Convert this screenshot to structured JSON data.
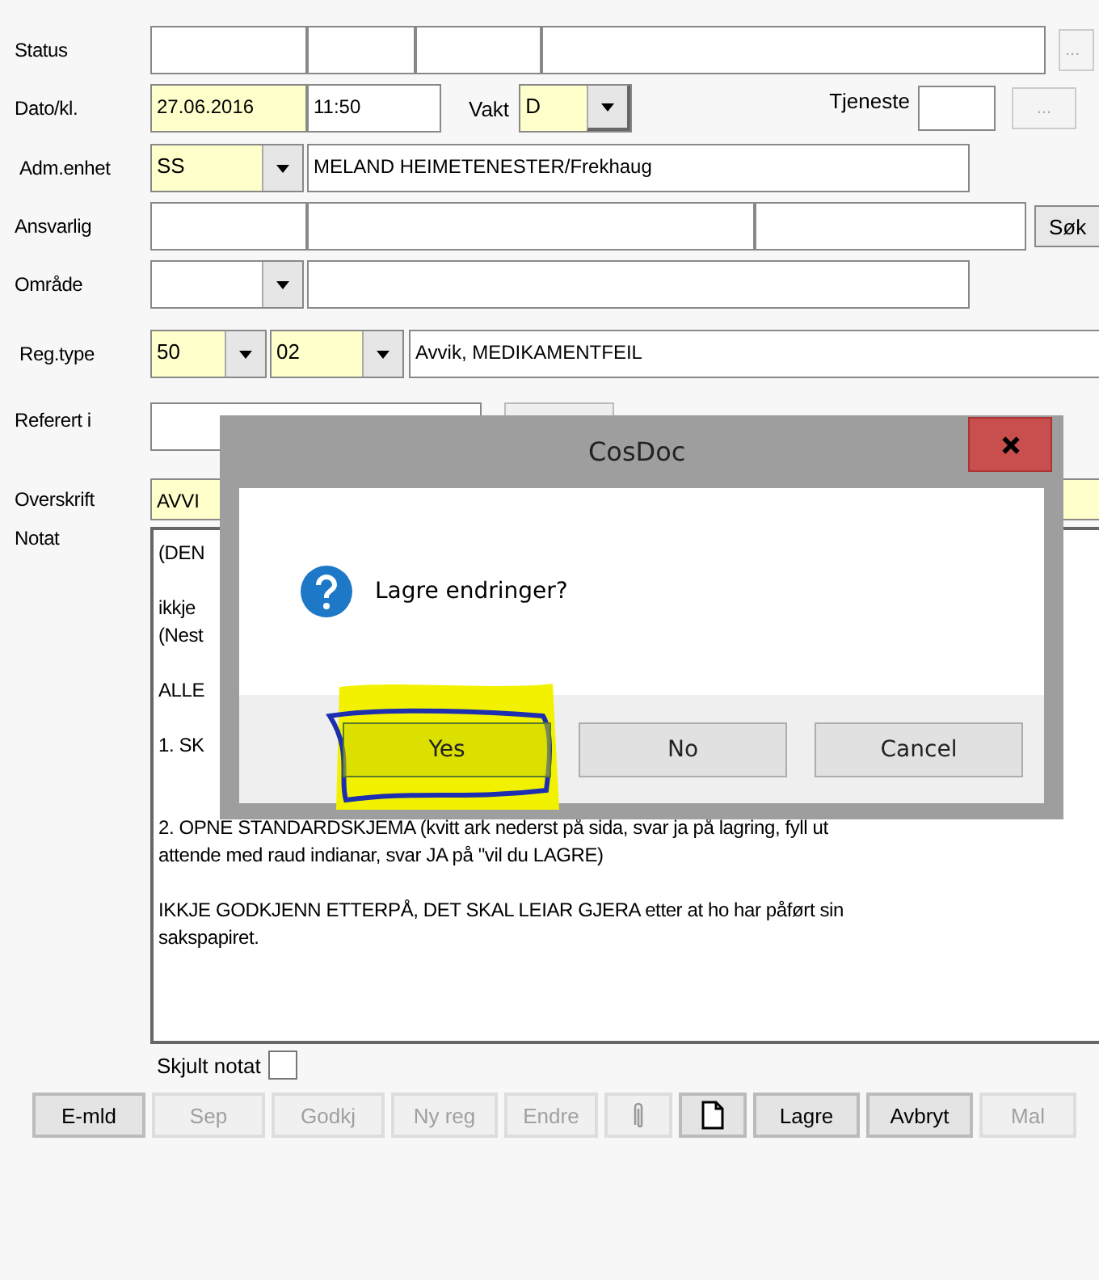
{
  "status": {
    "label": "Status",
    "fields": [
      {
        "required": false
      },
      {
        "required": false
      },
      {
        "required": false
      },
      {
        "required": false
      }
    ],
    "more_button": "..."
  },
  "date": {
    "label": "Dato/kl.",
    "date": "27.06.2016",
    "date_required": true,
    "time": "11:50",
    "shift_label": "Vakt",
    "shift": "D",
    "shift_required": true,
    "service_label": "Tjeneste",
    "more_button": "..."
  },
  "unit": {
    "label": "Adm.enhet",
    "code": "SS",
    "code_required": true,
    "name": "MELAND HEIMETENESTER/Frekhaug"
  },
  "responsible": {
    "label": "Ansvarlig",
    "search_button": "Søk"
  },
  "area": {
    "label": "Område"
  },
  "reg_type": {
    "label": "Reg.type",
    "code": "50",
    "subcode": "02",
    "required": true,
    "description": "Avvik, MEDIKAMENTFEIL"
  },
  "referred": {
    "label": "Referert i"
  },
  "heading": {
    "label": "Overskrift",
    "value": "AVVI",
    "required": true
  },
  "note": {
    "label": "Notat",
    "paragraphs": [
      [
        "(DEN"
      ],
      [
        "ikkje",
        "(Nest"
      ],
      [
        "ALLE"
      ],
      [
        "1. SK"
      ],
      [
        "2. OPNE  STANDARDSKJEMA (kvitt ark nederst på sida, svar ja på lagring, fyll ut",
        "attende med raud indianar, svar JA  på \"vil du LAGRE)"
      ],
      [
        "IKKJE GODKJENN ETTERPÅ, DET SKAL LEIAR GJERA etter at ho har påført sin",
        "sakspapiret."
      ]
    ]
  },
  "hide_note": {
    "label": "Skjult notat",
    "checked": false
  },
  "toolbar": [
    {
      "kind": "text",
      "label": "E-mld",
      "disabled": false
    },
    {
      "kind": "text",
      "label": "Sep",
      "disabled": true
    },
    {
      "kind": "text",
      "label": "Godkj",
      "disabled": true
    },
    {
      "kind": "text",
      "label": "Ny reg",
      "disabled": true
    },
    {
      "kind": "text",
      "label": "Endre",
      "disabled": true
    },
    {
      "kind": "icon",
      "disabled": true
    },
    {
      "kind": "icon",
      "disabled": false
    },
    {
      "kind": "text",
      "label": "Lagre",
      "disabled": false
    },
    {
      "kind": "text",
      "label": "Avbryt",
      "disabled": false
    },
    {
      "kind": "text",
      "label": "Mal",
      "disabled": true
    }
  ],
  "dialog": {
    "title": "CosDoc",
    "message": "Lagre endringer?",
    "buttons": [
      {
        "label": "Yes",
        "selected": true,
        "highlighted": true
      },
      {
        "label": "No",
        "selected": false,
        "highlighted": false
      },
      {
        "label": "Cancel",
        "selected": false,
        "highlighted": false
      }
    ]
  }
}
